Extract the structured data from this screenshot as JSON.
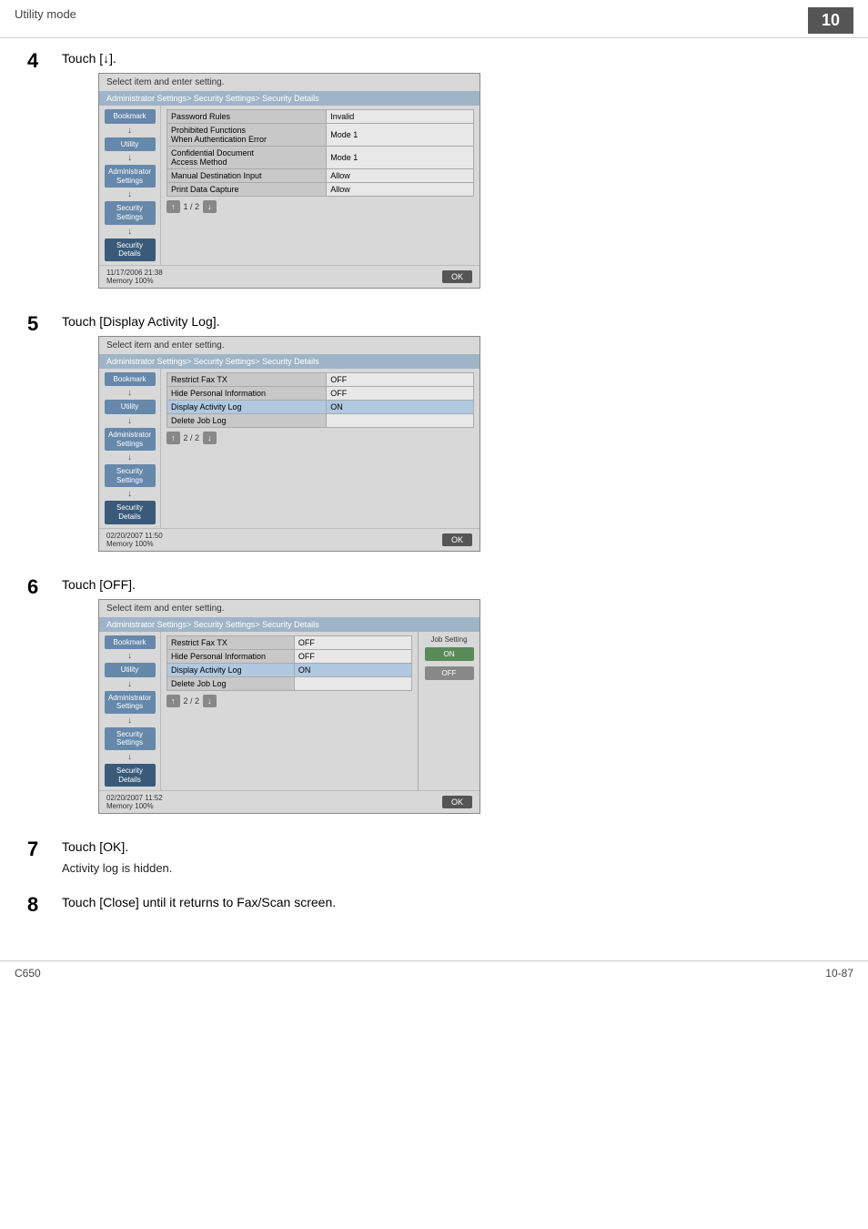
{
  "header": {
    "utility_mode": "Utility mode",
    "page_number": "10"
  },
  "steps": [
    {
      "number": "4",
      "instruction": "Touch [↓].",
      "screen": {
        "top_text": "Select item and enter setting.",
        "breadcrumb": "Administrator Settings> Security Settings> Security Details",
        "sidebar_items": [
          {
            "label": "Bookmark",
            "active": false
          },
          {
            "label": "Utility",
            "active": false
          },
          {
            "label": "Administrator\nSettings",
            "active": false
          },
          {
            "label": "Security\nSettings",
            "active": false
          },
          {
            "label": "Security Details",
            "active": true
          }
        ],
        "table_rows": [
          {
            "label": "Password Rules",
            "value": "Invalid"
          },
          {
            "label": "Prohibited Functions\nWhen Authentication Error",
            "value": "Mode 1"
          },
          {
            "label": "Confidential Document\nAccess Method",
            "value": "Mode 1"
          },
          {
            "label": "Manual Destination Input",
            "value": "Allow"
          },
          {
            "label": "Print Data Capture",
            "value": "Allow"
          }
        ],
        "pagination": "1 / 2",
        "datetime": "11/17/2006  21:38",
        "memory": "Memory  100%"
      }
    },
    {
      "number": "5",
      "instruction": "Touch [Display Activity Log].",
      "screen": {
        "top_text": "Select item and enter setting.",
        "breadcrumb": "Administrator Settings> Security Settings> Security Details",
        "sidebar_items": [
          {
            "label": "Bookmark",
            "active": false
          },
          {
            "label": "Utility",
            "active": false
          },
          {
            "label": "Administrator\nSettings",
            "active": false
          },
          {
            "label": "Security\nSettings",
            "active": false
          },
          {
            "label": "Security Details",
            "active": true
          }
        ],
        "table_rows": [
          {
            "label": "Restrict Fax TX",
            "value": "OFF"
          },
          {
            "label": "Hide Personal Information",
            "value": "OFF"
          },
          {
            "label": "Display Activity Log",
            "value": "ON",
            "highlighted": true
          },
          {
            "label": "Delete Job Log",
            "value": ""
          }
        ],
        "pagination": "2 / 2",
        "datetime": "02/20/2007  11:50",
        "memory": "Memory  100%"
      }
    },
    {
      "number": "6",
      "instruction": "Touch [OFF].",
      "screen": {
        "top_text": "Select item and enter setting.",
        "breadcrumb": "Administrator Settings> Security Settings> Security Details",
        "sidebar_items": [
          {
            "label": "Bookmark",
            "active": false
          },
          {
            "label": "Utility",
            "active": false
          },
          {
            "label": "Administrator\nSettings",
            "active": false
          },
          {
            "label": "Security\nSettings",
            "active": false
          },
          {
            "label": "Security Details",
            "active": true
          }
        ],
        "table_rows": [
          {
            "label": "Restrict Fax TX",
            "value": "OFF"
          },
          {
            "label": "Hide Personal Information",
            "value": "OFF"
          },
          {
            "label": "Display Activity Log",
            "value": "ON",
            "highlighted": true
          },
          {
            "label": "Delete Job Log",
            "value": ""
          }
        ],
        "job_setting": {
          "label": "Job Setting",
          "on_label": "ON",
          "off_label": "OFF"
        },
        "pagination": "2 / 2",
        "datetime": "02/20/2007  11:52",
        "memory": "Memory  100%"
      }
    }
  ],
  "steps_text_only": [
    {
      "number": "7",
      "instruction": "Touch [OK].",
      "sub_text": "Activity log is hidden."
    },
    {
      "number": "8",
      "instruction": "Touch [Close] until it returns to Fax/Scan screen."
    }
  ],
  "footer": {
    "model": "C650",
    "page": "10-87"
  }
}
